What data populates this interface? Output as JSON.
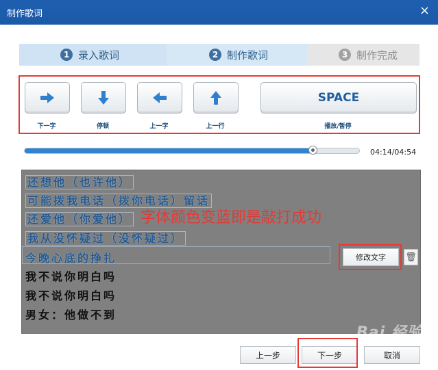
{
  "window": {
    "title": "制作歌词",
    "close_glyph": "×"
  },
  "steps": [
    {
      "num": "1",
      "label": "录入歌词"
    },
    {
      "num": "2",
      "label": "制作歌词"
    },
    {
      "num": "3",
      "label": "制作完成"
    }
  ],
  "controls": {
    "next_char": "下一字",
    "pause": "停顿",
    "prev_char": "上一字",
    "prev_line": "上一行",
    "space_key": "SPACE",
    "space_label": "播放/暂停"
  },
  "player": {
    "progress": 0.86,
    "time": "04:14/04:54"
  },
  "lyrics": {
    "done_lines": [
      "还想他（也许他）",
      "可能拨我电话（拨你电话）留话",
      "还爱他（你爱他）",
      "我从没怀疑过（没怀疑过）"
    ],
    "current_line": "今晚心底的挣扎",
    "todo_lines": [
      "我不说你明白吗",
      "我不说你明白吗",
      "男女：他做不到"
    ],
    "annotation": "字体颜色变蓝即是敲打成功",
    "edit_button": "修改文字",
    "trash_icon": "🗑"
  },
  "footer": {
    "prev": "上一步",
    "next": "下一步",
    "cancel": "取消"
  },
  "watermark": "Bai 经验"
}
